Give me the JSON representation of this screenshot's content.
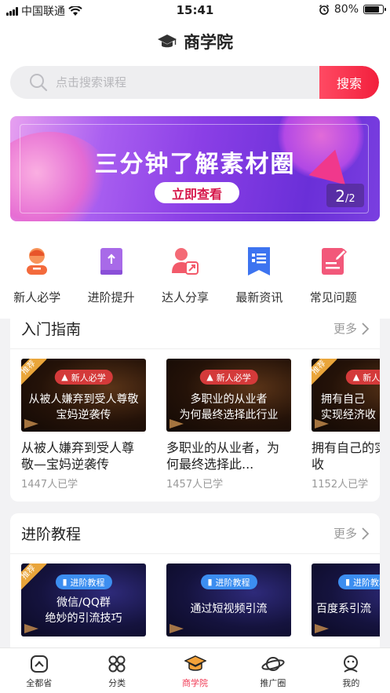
{
  "status_bar": {
    "carrier": "中国联通",
    "time": "15:41",
    "battery_percent": "80%",
    "battery_level": 0.8,
    "icons": [
      "signal-icon",
      "wifi-icon",
      "alarm-icon",
      "battery-icon"
    ]
  },
  "header": {
    "icon": "graduation-cap-icon",
    "title": "商学院"
  },
  "search": {
    "placeholder": "点击搜索课程",
    "button_label": "搜索"
  },
  "banner": {
    "title": "三分钟了解素材圈",
    "button_label": "立即查看",
    "page_current": "2",
    "page_separator": "/",
    "page_total": "2"
  },
  "categories": [
    {
      "label": "新人必学",
      "icon": "newcomer-icon",
      "color": "#f36a3c"
    },
    {
      "label": "进阶提升",
      "icon": "book-icon",
      "color": "#9b59e6"
    },
    {
      "label": "达人分享",
      "icon": "share-user-icon",
      "color": "#f25a6a"
    },
    {
      "label": "最新资讯",
      "icon": "news-icon",
      "color": "#3d74f0"
    },
    {
      "label": "常见问题",
      "icon": "faq-icon",
      "color": "#f2587a"
    }
  ],
  "guide": {
    "title": "入门指南",
    "more_label": "更多",
    "courses": [
      {
        "ribbon": "推荐",
        "tag": "新人必学",
        "thumb_text": "从被人嫌弃到受人尊敬\n宝妈逆袭传",
        "title": "从被人嫌弃到受人尊敬—宝妈逆袭传",
        "learners": "1447人已学"
      },
      {
        "ribbon": "",
        "tag": "新人必学",
        "thumb_text": "多职业的从业者\n为何最终选择此行业",
        "title": "多职业的从业者，为何最终选择此...",
        "learners": "1457人已学"
      },
      {
        "ribbon": "推荐",
        "tag": "新人",
        "thumb_text": "拥有自己\n实现经济收",
        "title": "拥有自己的实现经济收",
        "learners": "1152人已学"
      }
    ]
  },
  "advanced": {
    "title": "进阶教程",
    "more_label": "更多",
    "courses": [
      {
        "ribbon": "推荐",
        "tag": "进阶教程",
        "thumb_text": "微信/QQ群\n绝妙的引流技巧"
      },
      {
        "ribbon": "",
        "tag": "进阶教程",
        "thumb_text": "通过短视频引流"
      },
      {
        "ribbon": "",
        "tag": "进阶教程",
        "thumb_text": "百度系引流"
      }
    ]
  },
  "tabbar": [
    {
      "label": "全都省",
      "icon": "home-icon",
      "active": false
    },
    {
      "label": "分类",
      "icon": "category-icon",
      "active": false
    },
    {
      "label": "商学院",
      "icon": "graduation-cap-icon",
      "active": true
    },
    {
      "label": "推广圈",
      "icon": "planet-icon",
      "active": false
    },
    {
      "label": "我的",
      "icon": "profile-icon",
      "active": false
    }
  ],
  "colors": {
    "accent": "#f03b56",
    "search_button": "#f21f3c",
    "tag_red": "#d43a3a",
    "tag_blue": "#3c8ef0"
  }
}
